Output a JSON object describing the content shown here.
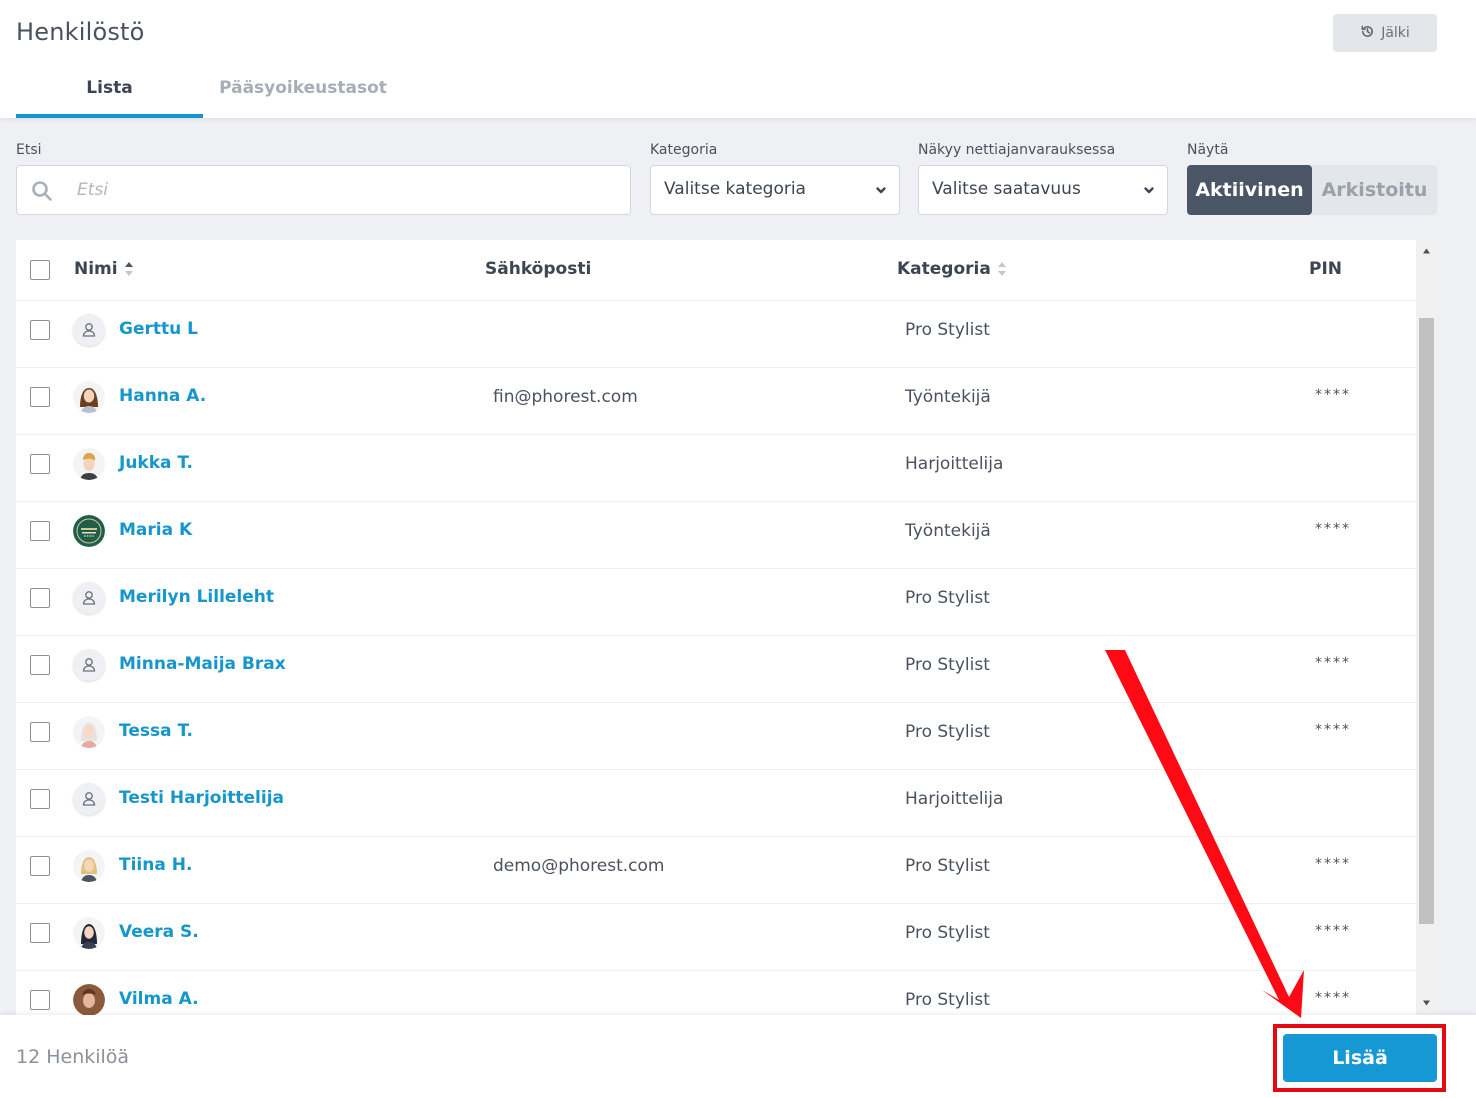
{
  "header": {
    "title": "Henkilöstö",
    "history_label": "Jälki",
    "tabs": [
      {
        "label": "Lista",
        "active": true
      },
      {
        "label": "Pääsyoikeustasot",
        "active": false
      }
    ]
  },
  "filters": {
    "search_label": "Etsi",
    "search_placeholder": "Etsi",
    "search_value": "",
    "category_label": "Kategoria",
    "category_value": "Valitse kategoria",
    "online_label": "Näkyy nettiajanvarauksessa",
    "online_value": "Valitse saatavuus",
    "show_label": "Näytä",
    "show_options": [
      "Aktiivinen",
      "Arkistoitu"
    ],
    "show_selected": "Aktiivinen"
  },
  "table": {
    "columns": [
      "Nimi",
      "Sähköposti",
      "Kategoria",
      "PIN"
    ],
    "rows": [
      {
        "name": "Gerttu L",
        "email": "",
        "category": "Pro Stylist",
        "pin": "",
        "avatar": "generic-person-icon"
      },
      {
        "name": "Hanna A.",
        "email": "fin@phorest.com",
        "category": "Työntekijä",
        "pin": "****",
        "avatar": "woman-brown-hair-avatar"
      },
      {
        "name": "Jukka T.",
        "email": "",
        "category": "Harjoittelija",
        "pin": "",
        "avatar": "man-blond-avatar"
      },
      {
        "name": "Maria K",
        "email": "",
        "category": "Työntekijä",
        "pin": "****",
        "avatar": "green-badge-avatar"
      },
      {
        "name": "Merilyn Lilleleht",
        "email": "",
        "category": "Pro Stylist",
        "pin": "",
        "avatar": "generic-person-icon"
      },
      {
        "name": "Minna-Maija Brax",
        "email": "",
        "category": "Pro Stylist",
        "pin": "****",
        "avatar": "generic-person-icon"
      },
      {
        "name": "Tessa T.",
        "email": "",
        "category": "Pro Stylist",
        "pin": "****",
        "avatar": "woman-white-hair-avatar"
      },
      {
        "name": "Testi Harjoittelija",
        "email": "",
        "category": "Harjoittelija",
        "pin": "",
        "avatar": "generic-person-icon"
      },
      {
        "name": "Tiina H.",
        "email": "demo@phorest.com",
        "category": "Pro Stylist",
        "pin": "****",
        "avatar": "woman-blonde-avatar"
      },
      {
        "name": "Veera S.",
        "email": "",
        "category": "Pro Stylist",
        "pin": "****",
        "avatar": "woman-dark-hair-avatar"
      },
      {
        "name": "Vilma A.",
        "email": "",
        "category": "Pro Stylist",
        "pin": "****",
        "avatar": "woman-photo-avatar"
      }
    ]
  },
  "footer": {
    "count_label": "12 Henkilöä",
    "add_label": "Lisää"
  },
  "colors": {
    "accent": "#1598d3",
    "link": "#1796cc",
    "toggle_active": "#4a5566",
    "annotation": "#e50914"
  }
}
